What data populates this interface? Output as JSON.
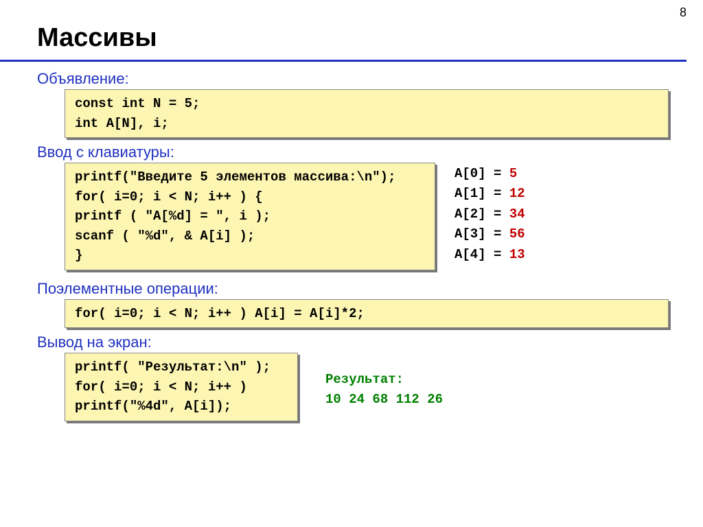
{
  "pageNumber": "8",
  "title": "Массивы",
  "sections": {
    "declaration": {
      "label": "Объявление:",
      "lines": [
        "const int N = 5;",
        "int A[N], i;"
      ]
    },
    "input": {
      "label": "Ввод с клавиатуры:",
      "lines": [
        "printf(\"Введите 5 элементов массива:\\n\");",
        "for( i=0; i < N; i++ ) {",
        "  printf ( \"A[%d] = \", i );",
        "  scanf ( \"%d\", & A[i] );",
        "  }"
      ],
      "sample": [
        {
          "prefix": "A[0] =",
          "value": "5"
        },
        {
          "prefix": "A[1] =",
          "value": "12"
        },
        {
          "prefix": "A[2] =",
          "value": "34"
        },
        {
          "prefix": "A[3] =",
          "value": "56"
        },
        {
          "prefix": "A[4] =",
          "value": "13"
        }
      ]
    },
    "elementwise": {
      "label": "Поэлементные операции:",
      "lines": [
        "for( i=0; i < N; i++ ) A[i] = A[i]*2;"
      ]
    },
    "output": {
      "label": "Вывод на экран:",
      "lines": [
        "printf( \"Результат:\\n\" );",
        "for( i=0; i < N; i++ )",
        "  printf(\"%4d\", A[i]);"
      ],
      "resultLabel": "Результат:",
      "resultValues": " 10  24  68 112  26"
    }
  }
}
